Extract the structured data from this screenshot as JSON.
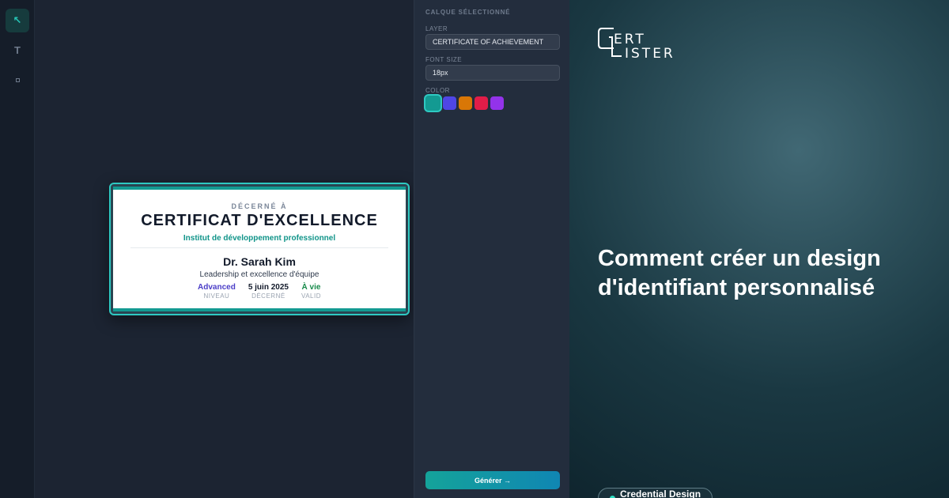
{
  "toolbar": {
    "tools": [
      {
        "name": "select",
        "glyph": "↖",
        "active": true
      },
      {
        "name": "text",
        "glyph": "T",
        "active": false
      },
      {
        "name": "shape",
        "glyph": "",
        "active": false
      }
    ]
  },
  "certificate": {
    "awarded_to": "DÉCERNÉ À",
    "title": "CERTIFICAT D'EXCELLENCE",
    "institute": "Institut de développement professionnel",
    "recipient": "Dr. Sarah Kim",
    "program": "Leadership et excellence d'équipe",
    "stats": [
      {
        "value": "Advanced",
        "label": "NIVEAU"
      },
      {
        "value": "5 juin 2025",
        "label": "DÉCERNÉ"
      },
      {
        "value": "À vie",
        "label": "VALID"
      }
    ]
  },
  "panel": {
    "title": "CALQUE SÉLECTIONNÉ",
    "layer_label": "LAYER",
    "layer_value": "CERTIFICATE OF ACHIEVEMENT",
    "font_size_label": "FONT SIZE",
    "font_size_value": "18px",
    "color_label": "COLOR",
    "swatches": [
      "#139a92",
      "#4f46e5",
      "#d97706",
      "#e11d48",
      "#9333ea"
    ],
    "selected_swatch": 0,
    "generate_label": "Générer →"
  },
  "hero": {
    "logo_text": "CERTLISTER",
    "headline": "Comment créer un design d'identifiant personnalisé",
    "badge": "Credential Design"
  },
  "colors": {
    "accent": "#2ec9c2",
    "panel_bg": "#232d3d",
    "canvas_bg": "#1c2432"
  }
}
